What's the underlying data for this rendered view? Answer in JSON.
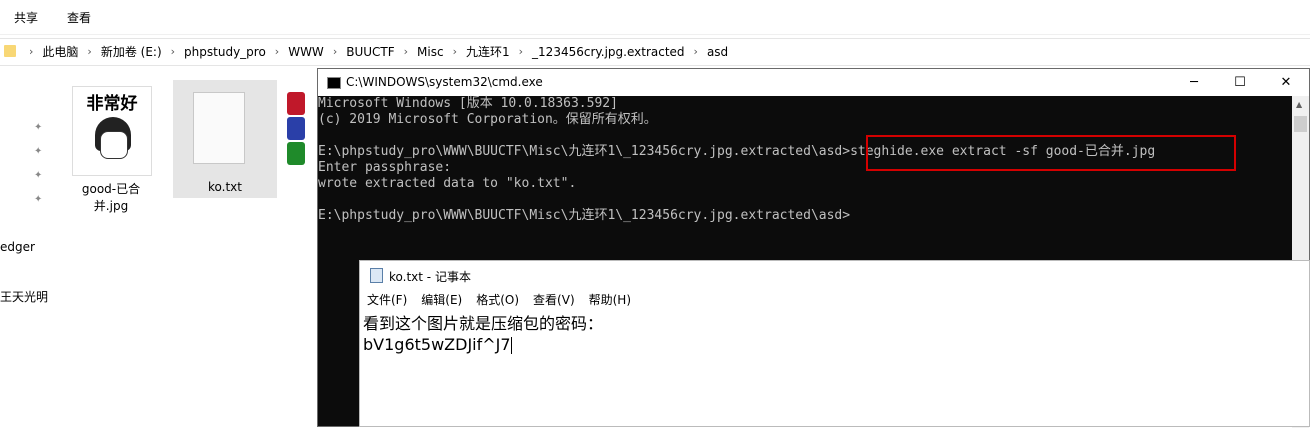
{
  "ribbon": {
    "share": "共享",
    "view": "查看"
  },
  "breadcrumb": [
    "此电脑",
    "新加卷 (E:)",
    "phpstudy_pro",
    "WWW",
    "BUUCTF",
    "Misc",
    "九连环1",
    "_123456cry.jpg.extracted",
    "asd"
  ],
  "nav": {
    "item1": "edger",
    "item2": "王天光明"
  },
  "files": [
    {
      "name": "good-已合并.jpg",
      "thumb_text": "非常好"
    },
    {
      "name": "ko.txt"
    }
  ],
  "cmd": {
    "title": "C:\\WINDOWS\\system32\\cmd.exe",
    "lines": [
      "Microsoft Windows [版本 10.0.18363.592]",
      "(c) 2019 Microsoft Corporation。保留所有权利。",
      "",
      "E:\\phpstudy_pro\\WWW\\BUUCTF\\Misc\\九连环1\\_123456cry.jpg.extracted\\asd>steghide.exe extract -sf good-已合并.jpg",
      "Enter passphrase:",
      "wrote extracted data to \"ko.txt\".",
      "",
      "E:\\phpstudy_pro\\WWW\\BUUCTF\\Misc\\九连环1\\_123456cry.jpg.extracted\\asd>"
    ]
  },
  "notepad": {
    "title": "ko.txt - 记事本",
    "menu": [
      "文件(F)",
      "编辑(E)",
      "格式(O)",
      "查看(V)",
      "帮助(H)"
    ],
    "content": [
      "看到这个图片就是压缩包的密码：",
      "bV1g6t5wZDJif^J7"
    ]
  }
}
